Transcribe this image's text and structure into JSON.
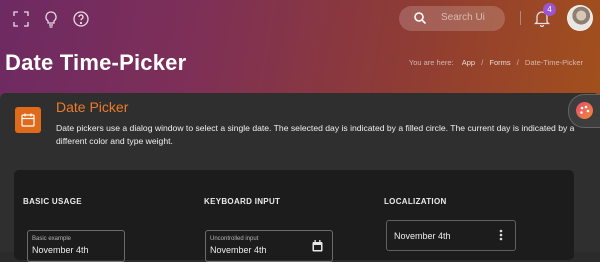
{
  "header": {
    "search_placeholder": "Search Ui",
    "notification_count": "4",
    "icons": [
      "fullscreen-icon",
      "lightbulb-icon",
      "help-icon",
      "search-icon",
      "bell-icon"
    ]
  },
  "page": {
    "title": "Date Time-Picker",
    "breadcrumb": {
      "prefix": "You are here:",
      "items": [
        "App",
        "Forms",
        "Date-Time-Picker"
      ]
    }
  },
  "card": {
    "title": "Date Picker",
    "description": "Date pickers use a dialog window to select a single date. The selected day is indicated by a filled circle. The current day is indicated by a different color and type weight.",
    "icon": "calendar-icon",
    "accent": "#e06a1c"
  },
  "sections": {
    "basic": {
      "title": "BASIC USAGE",
      "field_label": "Basic example",
      "field_value": "November 4th"
    },
    "keyboard": {
      "title": "KEYBOARD INPUT",
      "field_label": "Uncontrolled input",
      "field_value": "November 4th"
    },
    "localization": {
      "title": "LOCALIZATION",
      "field_value": "November 4th"
    }
  },
  "colors": {
    "badge": "#9c55d0",
    "title_accent": "#ee7a2a"
  }
}
